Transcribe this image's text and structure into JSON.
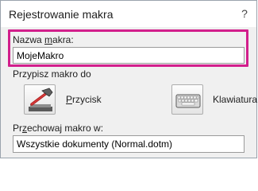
{
  "dialog": {
    "title": "Rejestrowanie makra",
    "help_glyph": "?",
    "highlight_color": "#d21f8c"
  },
  "macro_name": {
    "label_pre": "Nazwa ",
    "label_accel": "m",
    "label_post": "akra:",
    "value": "MojeMakro"
  },
  "assign": {
    "section_label": "Przypisz makro do",
    "button": {
      "label_accel": "P",
      "label_post": "rzycisk",
      "icon": "hammer-icon"
    },
    "keyboard": {
      "label_pre": "Klawiatura",
      "icon": "keyboard-icon"
    }
  },
  "store": {
    "label_pre": "Pr",
    "label_accel": "z",
    "label_post": "echowaj makro w:",
    "value": "Wszystkie dokumenty (Normal.dotm)"
  }
}
